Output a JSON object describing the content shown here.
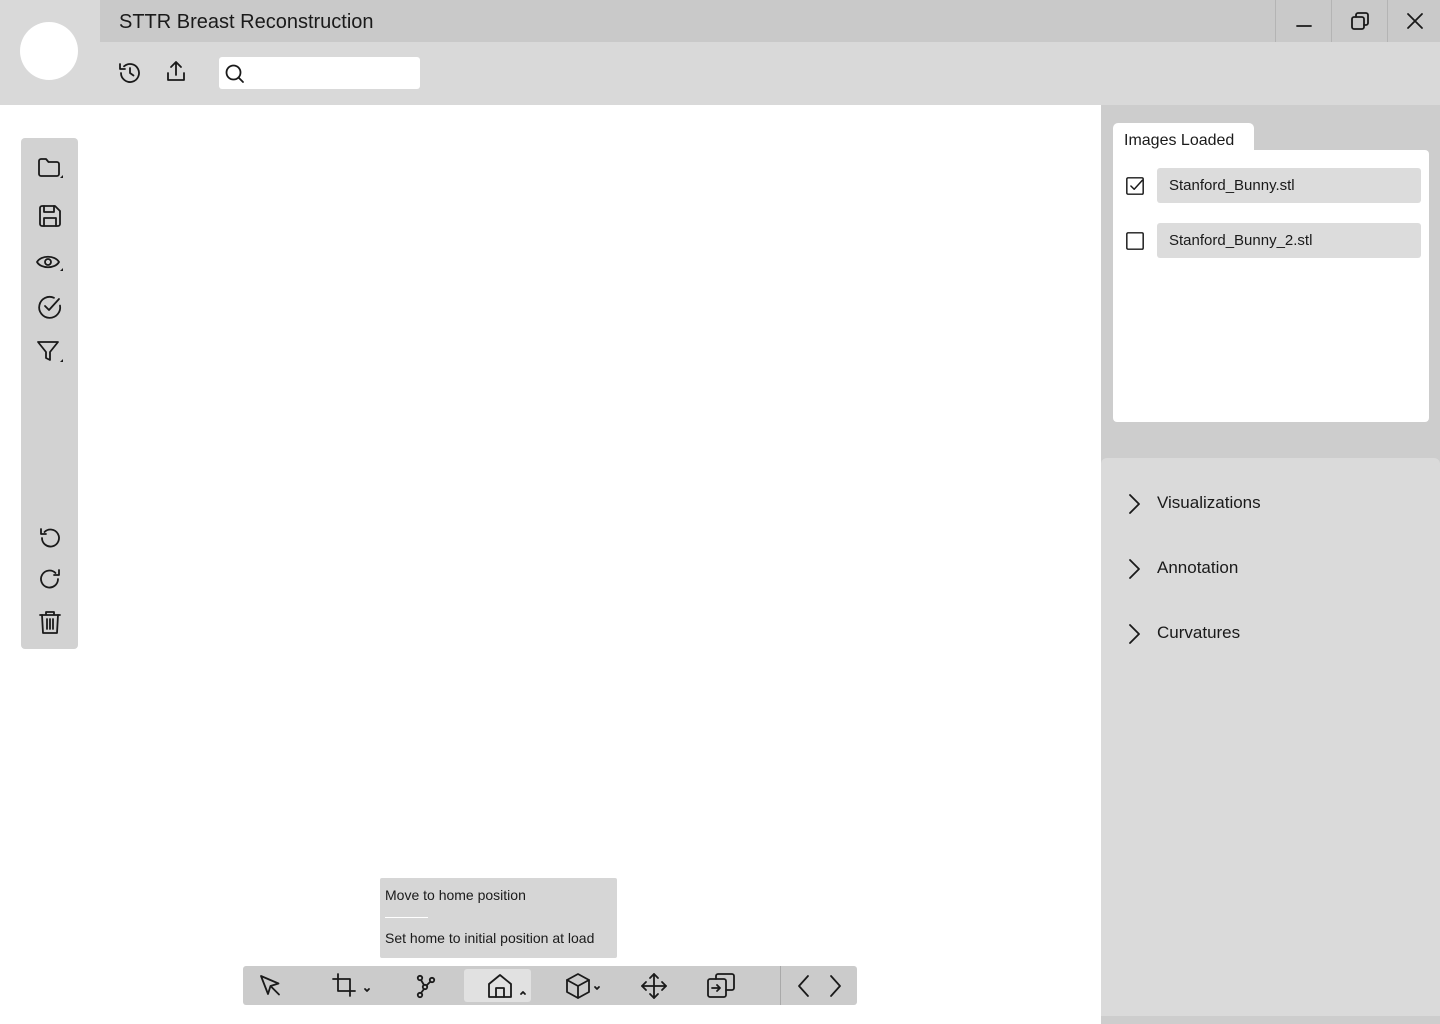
{
  "app": {
    "title": "STTR Breast Reconstruction"
  },
  "header": {
    "search": {
      "value": "",
      "placeholder": ""
    },
    "icons": [
      "history-icon",
      "share-icon",
      "search-icon"
    ]
  },
  "window_controls": [
    "minimize-icon",
    "restore-icon",
    "close-icon"
  ],
  "left_toolbar": {
    "tools": [
      "open-folder-icon",
      "save-icon",
      "view-icon",
      "check-circle-icon",
      "filter-icon",
      "undo-icon",
      "redo-icon",
      "trash-icon"
    ]
  },
  "right_panel": {
    "tab_label": "Images Loaded",
    "images": [
      {
        "name": "Stanford_Bunny.stl",
        "checked": true
      },
      {
        "name": "Stanford_Bunny_2.stl",
        "checked": false
      }
    ],
    "sections": [
      {
        "label": "Visualizations"
      },
      {
        "label": "Annotation"
      },
      {
        "label": "Curvatures"
      }
    ]
  },
  "home_popup": {
    "items": [
      "Move to home position",
      "Set home to initial position at load"
    ]
  },
  "bottom_toolbar": {
    "tools": [
      "pointer-icon",
      "crop-icon",
      "nodes-icon",
      "home-icon",
      "cube-icon",
      "move-icon",
      "import-icon",
      "chevron-left-icon",
      "chevron-right-icon"
    ],
    "active_tool": "home-icon"
  },
  "colors": {
    "header": "#d9d9d9",
    "titlebar": "#c9c9c9",
    "panel": "#cdcdcd",
    "canvas": "#ffffff"
  }
}
